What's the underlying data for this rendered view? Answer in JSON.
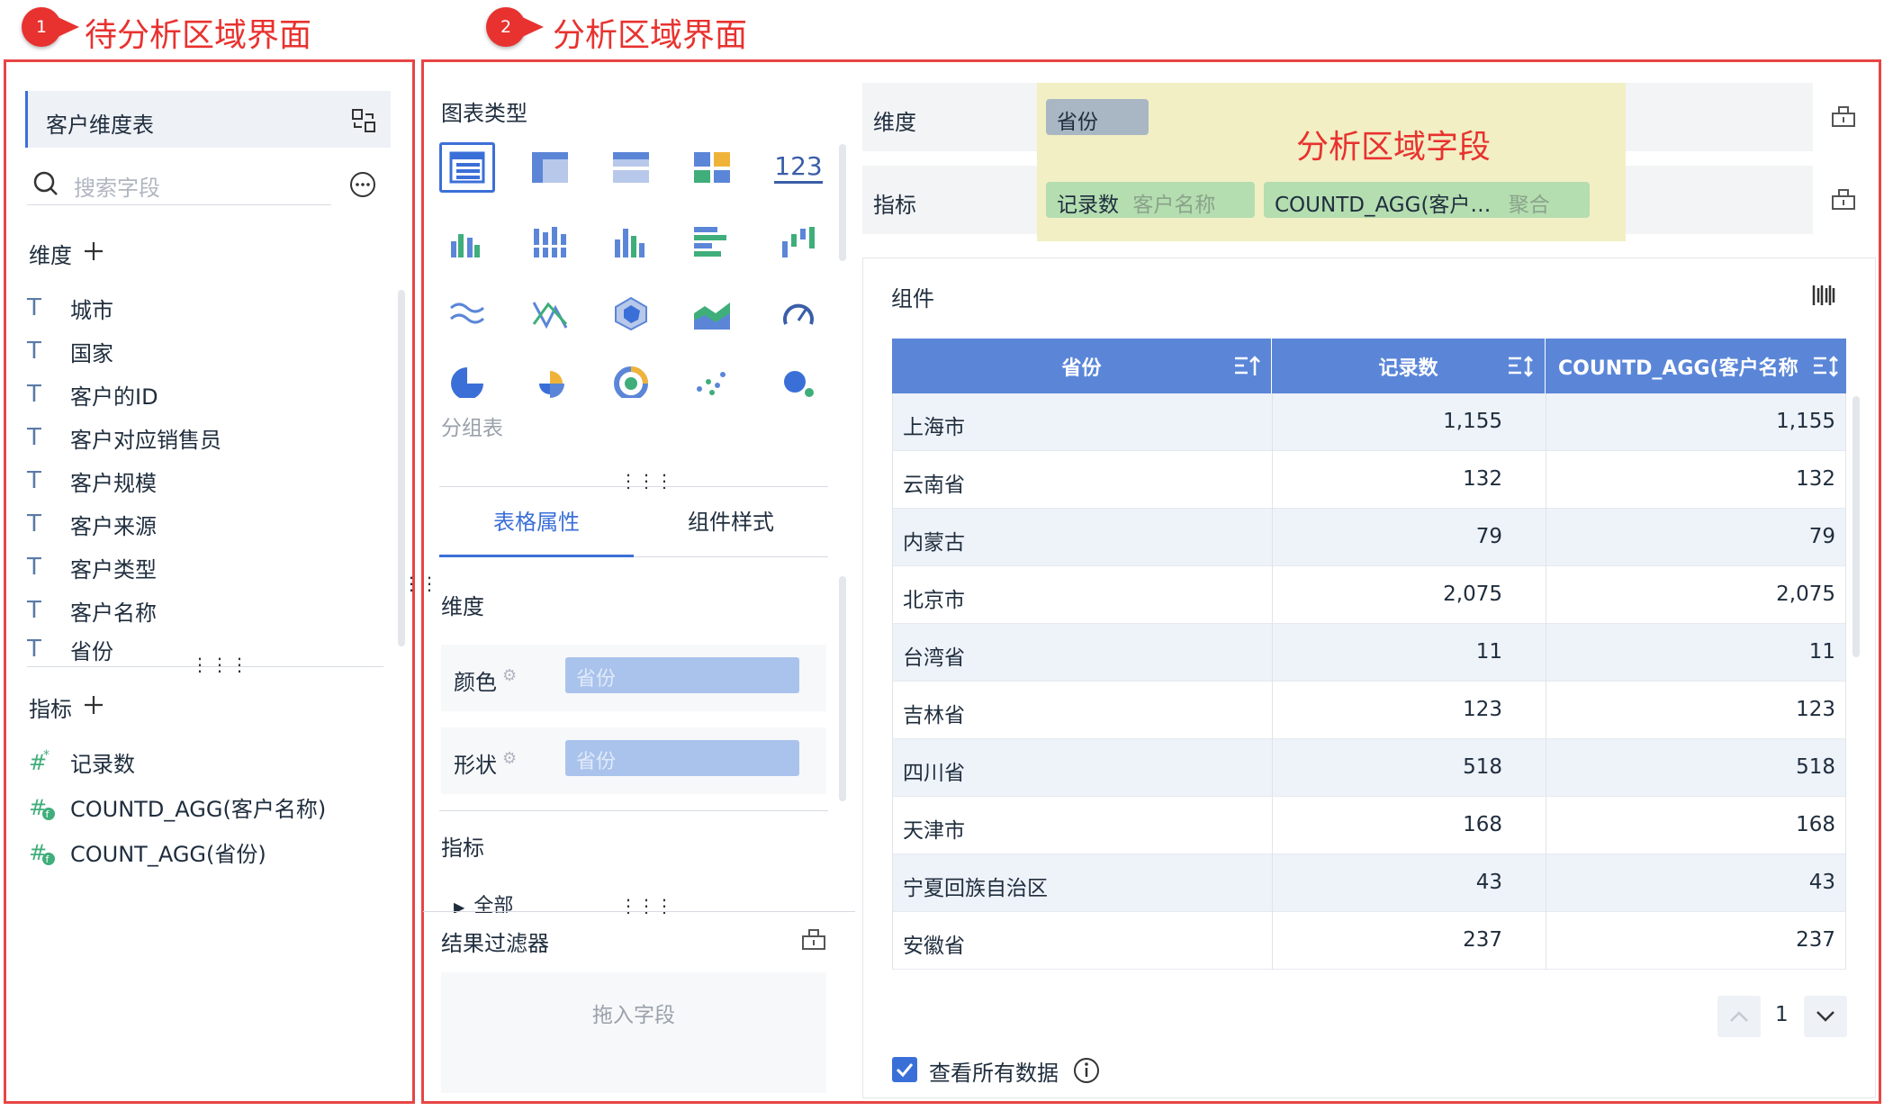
{
  "annotations": {
    "badge1": "1",
    "title1": "待分析区域界面",
    "badge2": "2",
    "title2": "分析区域界面",
    "yellow_label": "分析区域字段"
  },
  "left": {
    "table_name": "客户维度表",
    "search_placeholder": "搜索字段",
    "dim_label": "维度",
    "dimensions": [
      "城市",
      "国家",
      "客户的ID",
      "客户对应销售员",
      "客户规模",
      "客户来源",
      "客户类型",
      "客户名称",
      "省份"
    ],
    "measure_label": "指标",
    "measures": [
      "记录数",
      "COUNTD_AGG(客户名称)",
      "COUNT_AGG(省份)"
    ]
  },
  "middle": {
    "chart_type_label": "图表类型",
    "table_sub_label": "分组表",
    "tab_props": "表格属性",
    "tab_style": "组件样式",
    "dim_label": "维度",
    "color_label": "颜色",
    "color_value": "省份",
    "shape_label": "形状",
    "shape_value": "省份",
    "measure_label": "指标",
    "all_label": "全部",
    "filter_label": "结果过滤器",
    "drop_hint": "拖入字段",
    "number_icon_text": "123"
  },
  "right": {
    "dim_shelf_label": "维度",
    "dim_pill": "省份",
    "measure_shelf_label": "指标",
    "measure_pill1_name": "记录数",
    "measure_pill1_agg": "客户名称",
    "measure_pill2_name": "COUNTD_AGG(客户…",
    "measure_pill2_agg": "聚合",
    "component_label": "组件",
    "columns": [
      "省份",
      "记录数",
      "COUNTD_AGG(客户名称"
    ],
    "rows": [
      [
        "上海市",
        "1,155",
        "1,155"
      ],
      [
        "云南省",
        "132",
        "132"
      ],
      [
        "内蒙古",
        "79",
        "79"
      ],
      [
        "北京市",
        "2,075",
        "2,075"
      ],
      [
        "台湾省",
        "11",
        "11"
      ],
      [
        "吉林省",
        "123",
        "123"
      ],
      [
        "四川省",
        "518",
        "518"
      ],
      [
        "天津市",
        "168",
        "168"
      ],
      [
        "宁夏回族自治区",
        "43",
        "43"
      ],
      [
        "安徽省",
        "237",
        "237"
      ]
    ],
    "page_number": "1",
    "view_all_label": "查看所有数据",
    "view_all_checked": true
  },
  "colors": {
    "accent": "#3b6fd8",
    "annotation_red": "#e84545",
    "header_blue": "#5b86d8",
    "dim_pill": "#a9b7c4",
    "measure_pill": "#b4ddb0",
    "highlight_yellow": "#f2efc4"
  }
}
